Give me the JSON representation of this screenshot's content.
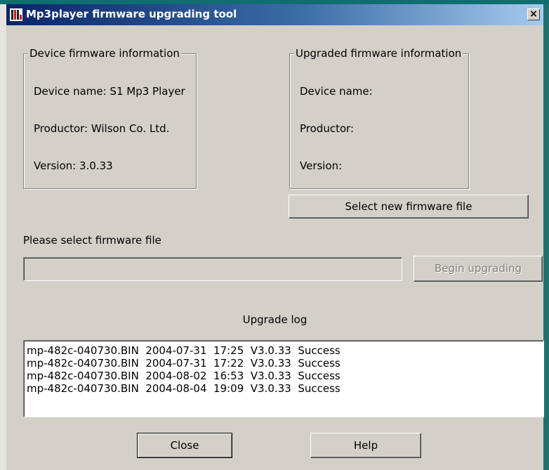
{
  "window": {
    "title": "Mp3player firmware upgrading tool",
    "close_glyph": "×"
  },
  "device_info": {
    "legend": "Device firmware information",
    "device_name": "Device name: S1 Mp3 Player",
    "productor": "Productor: Wilson Co. Ltd.",
    "version": "Version: 3.0.33"
  },
  "upgraded_info": {
    "legend": "Upgraded firmware information",
    "device_name": "Device name:",
    "productor": "Productor:",
    "version": "Version:"
  },
  "select_button": "Select new firmware file",
  "file_prompt": "Please select firmware file",
  "file_input": {
    "value": ""
  },
  "begin_button": "Begin upgrading",
  "log": {
    "title": "Upgrade log",
    "entries": [
      "mp-482c-040730.BIN  2004-07-31  17:25  V3.0.33  Success",
      "mp-482c-040730.BIN  2004-07-31  17:22  V3.0.33  Success",
      "mp-482c-040730.BIN  2004-08-02  16:53  V3.0.33  Success",
      "mp-482c-040730.BIN  2004-08-04  19:09  V3.0.33  Success"
    ]
  },
  "buttons": {
    "close": "Close",
    "help": "Help"
  },
  "icons": {
    "app": "app-logo-icon",
    "close": "close-icon"
  },
  "colors": {
    "title_bar": "#0a246a",
    "face": "#d4d0c8",
    "disabled_text": "#808080"
  }
}
